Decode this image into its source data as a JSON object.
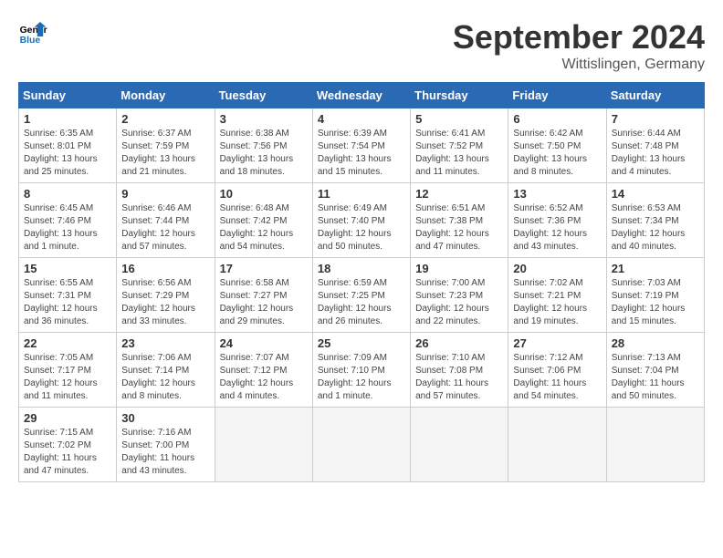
{
  "header": {
    "logo_general": "General",
    "logo_blue": "Blue",
    "month_year": "September 2024",
    "location": "Wittislingen, Germany"
  },
  "days_of_week": [
    "Sunday",
    "Monday",
    "Tuesday",
    "Wednesday",
    "Thursday",
    "Friday",
    "Saturday"
  ],
  "weeks": [
    [
      {
        "day": "1",
        "lines": [
          "Sunrise: 6:35 AM",
          "Sunset: 8:01 PM",
          "Daylight: 13 hours",
          "and 25 minutes."
        ]
      },
      {
        "day": "2",
        "lines": [
          "Sunrise: 6:37 AM",
          "Sunset: 7:59 PM",
          "Daylight: 13 hours",
          "and 21 minutes."
        ]
      },
      {
        "day": "3",
        "lines": [
          "Sunrise: 6:38 AM",
          "Sunset: 7:56 PM",
          "Daylight: 13 hours",
          "and 18 minutes."
        ]
      },
      {
        "day": "4",
        "lines": [
          "Sunrise: 6:39 AM",
          "Sunset: 7:54 PM",
          "Daylight: 13 hours",
          "and 15 minutes."
        ]
      },
      {
        "day": "5",
        "lines": [
          "Sunrise: 6:41 AM",
          "Sunset: 7:52 PM",
          "Daylight: 13 hours",
          "and 11 minutes."
        ]
      },
      {
        "day": "6",
        "lines": [
          "Sunrise: 6:42 AM",
          "Sunset: 7:50 PM",
          "Daylight: 13 hours",
          "and 8 minutes."
        ]
      },
      {
        "day": "7",
        "lines": [
          "Sunrise: 6:44 AM",
          "Sunset: 7:48 PM",
          "Daylight: 13 hours",
          "and 4 minutes."
        ]
      }
    ],
    [
      {
        "day": "8",
        "lines": [
          "Sunrise: 6:45 AM",
          "Sunset: 7:46 PM",
          "Daylight: 13 hours",
          "and 1 minute."
        ]
      },
      {
        "day": "9",
        "lines": [
          "Sunrise: 6:46 AM",
          "Sunset: 7:44 PM",
          "Daylight: 12 hours",
          "and 57 minutes."
        ]
      },
      {
        "day": "10",
        "lines": [
          "Sunrise: 6:48 AM",
          "Sunset: 7:42 PM",
          "Daylight: 12 hours",
          "and 54 minutes."
        ]
      },
      {
        "day": "11",
        "lines": [
          "Sunrise: 6:49 AM",
          "Sunset: 7:40 PM",
          "Daylight: 12 hours",
          "and 50 minutes."
        ]
      },
      {
        "day": "12",
        "lines": [
          "Sunrise: 6:51 AM",
          "Sunset: 7:38 PM",
          "Daylight: 12 hours",
          "and 47 minutes."
        ]
      },
      {
        "day": "13",
        "lines": [
          "Sunrise: 6:52 AM",
          "Sunset: 7:36 PM",
          "Daylight: 12 hours",
          "and 43 minutes."
        ]
      },
      {
        "day": "14",
        "lines": [
          "Sunrise: 6:53 AM",
          "Sunset: 7:34 PM",
          "Daylight: 12 hours",
          "and 40 minutes."
        ]
      }
    ],
    [
      {
        "day": "15",
        "lines": [
          "Sunrise: 6:55 AM",
          "Sunset: 7:31 PM",
          "Daylight: 12 hours",
          "and 36 minutes."
        ]
      },
      {
        "day": "16",
        "lines": [
          "Sunrise: 6:56 AM",
          "Sunset: 7:29 PM",
          "Daylight: 12 hours",
          "and 33 minutes."
        ]
      },
      {
        "day": "17",
        "lines": [
          "Sunrise: 6:58 AM",
          "Sunset: 7:27 PM",
          "Daylight: 12 hours",
          "and 29 minutes."
        ]
      },
      {
        "day": "18",
        "lines": [
          "Sunrise: 6:59 AM",
          "Sunset: 7:25 PM",
          "Daylight: 12 hours",
          "and 26 minutes."
        ]
      },
      {
        "day": "19",
        "lines": [
          "Sunrise: 7:00 AM",
          "Sunset: 7:23 PM",
          "Daylight: 12 hours",
          "and 22 minutes."
        ]
      },
      {
        "day": "20",
        "lines": [
          "Sunrise: 7:02 AM",
          "Sunset: 7:21 PM",
          "Daylight: 12 hours",
          "and 19 minutes."
        ]
      },
      {
        "day": "21",
        "lines": [
          "Sunrise: 7:03 AM",
          "Sunset: 7:19 PM",
          "Daylight: 12 hours",
          "and 15 minutes."
        ]
      }
    ],
    [
      {
        "day": "22",
        "lines": [
          "Sunrise: 7:05 AM",
          "Sunset: 7:17 PM",
          "Daylight: 12 hours",
          "and 11 minutes."
        ]
      },
      {
        "day": "23",
        "lines": [
          "Sunrise: 7:06 AM",
          "Sunset: 7:14 PM",
          "Daylight: 12 hours",
          "and 8 minutes."
        ]
      },
      {
        "day": "24",
        "lines": [
          "Sunrise: 7:07 AM",
          "Sunset: 7:12 PM",
          "Daylight: 12 hours",
          "and 4 minutes."
        ]
      },
      {
        "day": "25",
        "lines": [
          "Sunrise: 7:09 AM",
          "Sunset: 7:10 PM",
          "Daylight: 12 hours",
          "and 1 minute."
        ]
      },
      {
        "day": "26",
        "lines": [
          "Sunrise: 7:10 AM",
          "Sunset: 7:08 PM",
          "Daylight: 11 hours",
          "and 57 minutes."
        ]
      },
      {
        "day": "27",
        "lines": [
          "Sunrise: 7:12 AM",
          "Sunset: 7:06 PM",
          "Daylight: 11 hours",
          "and 54 minutes."
        ]
      },
      {
        "day": "28",
        "lines": [
          "Sunrise: 7:13 AM",
          "Sunset: 7:04 PM",
          "Daylight: 11 hours",
          "and 50 minutes."
        ]
      }
    ],
    [
      {
        "day": "29",
        "lines": [
          "Sunrise: 7:15 AM",
          "Sunset: 7:02 PM",
          "Daylight: 11 hours",
          "and 47 minutes."
        ]
      },
      {
        "day": "30",
        "lines": [
          "Sunrise: 7:16 AM",
          "Sunset: 7:00 PM",
          "Daylight: 11 hours",
          "and 43 minutes."
        ]
      },
      {
        "day": "",
        "lines": []
      },
      {
        "day": "",
        "lines": []
      },
      {
        "day": "",
        "lines": []
      },
      {
        "day": "",
        "lines": []
      },
      {
        "day": "",
        "lines": []
      }
    ]
  ]
}
